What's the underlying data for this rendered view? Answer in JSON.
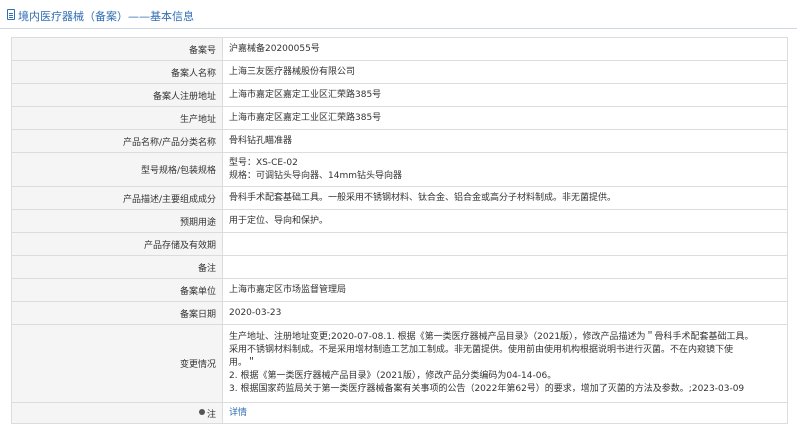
{
  "header": {
    "title": "境内医疗器械（备案）——基本信息"
  },
  "rows": [
    {
      "label": "备案号",
      "value": "沪嘉械备20200055号"
    },
    {
      "label": "备案人名称",
      "value": "上海三友医疗器械股份有限公司"
    },
    {
      "label": "备案人注册地址",
      "value": "上海市嘉定区嘉定工业区汇荣路385号"
    },
    {
      "label": "生产地址",
      "value": "上海市嘉定区嘉定工业区汇荣路385号"
    },
    {
      "label": "产品名称/产品分类名称",
      "value": "骨科钻孔瞄准器"
    },
    {
      "label": "型号规格/包装规格",
      "lines": [
        "型号：XS-CE-02",
        "规格：可调钻头导向器、14mm钻头导向器"
      ]
    },
    {
      "label": "产品描述/主要组成成分",
      "value": "骨科手术配套基础工具。一般采用不锈钢材料、钛合金、铝合金或高分子材料制成。非无菌提供。"
    },
    {
      "label": "预期用途",
      "value": "用于定位、导向和保护。"
    },
    {
      "label": "产品存储及有效期",
      "value": ""
    },
    {
      "label": "备注",
      "value": ""
    },
    {
      "label": "备案单位",
      "value": "上海市嘉定区市场监督管理局"
    },
    {
      "label": "备案日期",
      "value": "2020-03-23"
    },
    {
      "label": "变更情况",
      "lines": [
        "生产地址、注册地址变更;2020-07-08.1. 根据《第一类医疗器械产品目录》（2021版），修改产品描述为＂骨科手术配套基础工具。",
        "采用不锈钢材料制成。不是采用增材制造工艺加工制成。非无菌提供。使用前由使用机构根据说明书进行灭菌。不在内窥镜下使",
        "用。＂",
        "2. 根据《第一类医疗器械产品目录》（2021版），修改产品分类编码为04-14-06。",
        "3. 根据国家药监局关于第一类医疗器械备案有关事项的公告（2022年第62号）的要求，增加了灭菌的方法及参数。;2023-03-09"
      ]
    },
    {
      "label": "注",
      "value": "详情"
    }
  ]
}
